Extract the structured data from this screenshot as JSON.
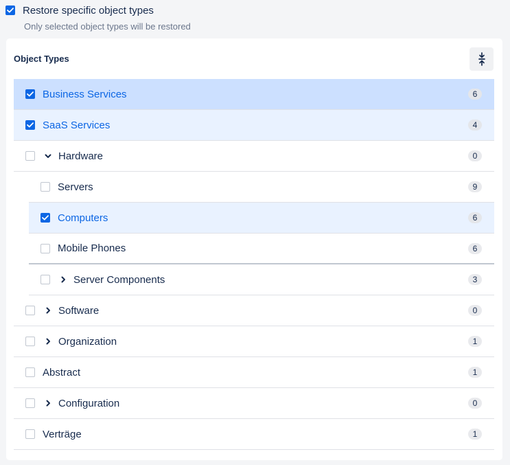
{
  "restore_option": {
    "label": "Restore specific object types",
    "checked": true,
    "description": "Only selected object types will be restored"
  },
  "panel": {
    "title": "Object Types",
    "collapse_icon": "collapse-all-icon"
  },
  "colors": {
    "accent": "#0c66e4",
    "selected_strong": "#cce0ff",
    "selected_light": "#e9f2ff"
  },
  "rows": [
    {
      "label": "Business Services",
      "count": "6",
      "checked": true,
      "level": 0,
      "chevron": "none"
    },
    {
      "label": "SaaS Services",
      "count": "4",
      "checked": true,
      "level": 0,
      "chevron": "none"
    },
    {
      "label": "Hardware",
      "count": "0",
      "checked": false,
      "level": 0,
      "chevron": "down"
    },
    {
      "label": "Servers",
      "count": "9",
      "checked": false,
      "level": 1,
      "chevron": "none"
    },
    {
      "label": "Computers",
      "count": "6",
      "checked": true,
      "level": 1,
      "chevron": "none"
    },
    {
      "label": "Mobile Phones",
      "count": "6",
      "checked": false,
      "level": 1,
      "chevron": "none"
    },
    {
      "label": "Server Components",
      "count": "3",
      "checked": false,
      "level": 1,
      "chevron": "right"
    },
    {
      "label": "Software",
      "count": "0",
      "checked": false,
      "level": 0,
      "chevron": "right"
    },
    {
      "label": "Organization",
      "count": "1",
      "checked": false,
      "level": 0,
      "chevron": "right"
    },
    {
      "label": "Abstract",
      "count": "1",
      "checked": false,
      "level": 0,
      "chevron": "none"
    },
    {
      "label": "Configuration",
      "count": "0",
      "checked": false,
      "level": 0,
      "chevron": "right"
    },
    {
      "label": "Verträge",
      "count": "1",
      "checked": false,
      "level": 0,
      "chevron": "none"
    }
  ]
}
